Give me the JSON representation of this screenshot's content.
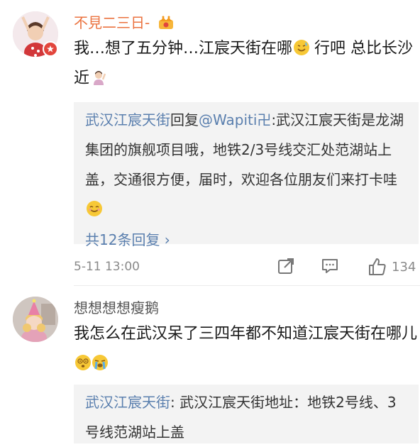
{
  "comments": [
    {
      "username": "不見二三日-",
      "text": "我…想了五分钟…江宸天街在哪",
      "text_after": " 行吧 总比长沙近",
      "reply": {
        "author": "武汉江宸天街",
        "connector": "回复",
        "mention": "@Wapiti卍",
        "text": ":武汉江宸天街是龙湖集团的旗舰项目哦，地铁2/3号线交汇处范湖站上盖，交通很方便，届时，欢迎各位朋友们来打卡哇",
        "more": "共12条回复 ›"
      },
      "time": "5-11 13:00",
      "likes": "134"
    },
    {
      "username": "想想想想瘦鹅",
      "text": "我怎么在武汉呆了三四年都不知道江宸天街在哪儿",
      "reply": {
        "author": "武汉江宸天街",
        "text": ": 武汉江宸天街地址：地铁2号线、3号线范湖站上盖"
      }
    }
  ],
  "colors": {
    "username_accent": "#eb7340",
    "link": "#5a7fae",
    "verified_badge": "#e2453c"
  },
  "icons": [
    "crown-icon",
    "share-icon",
    "comment-icon",
    "like-icon",
    "verified-icon"
  ]
}
